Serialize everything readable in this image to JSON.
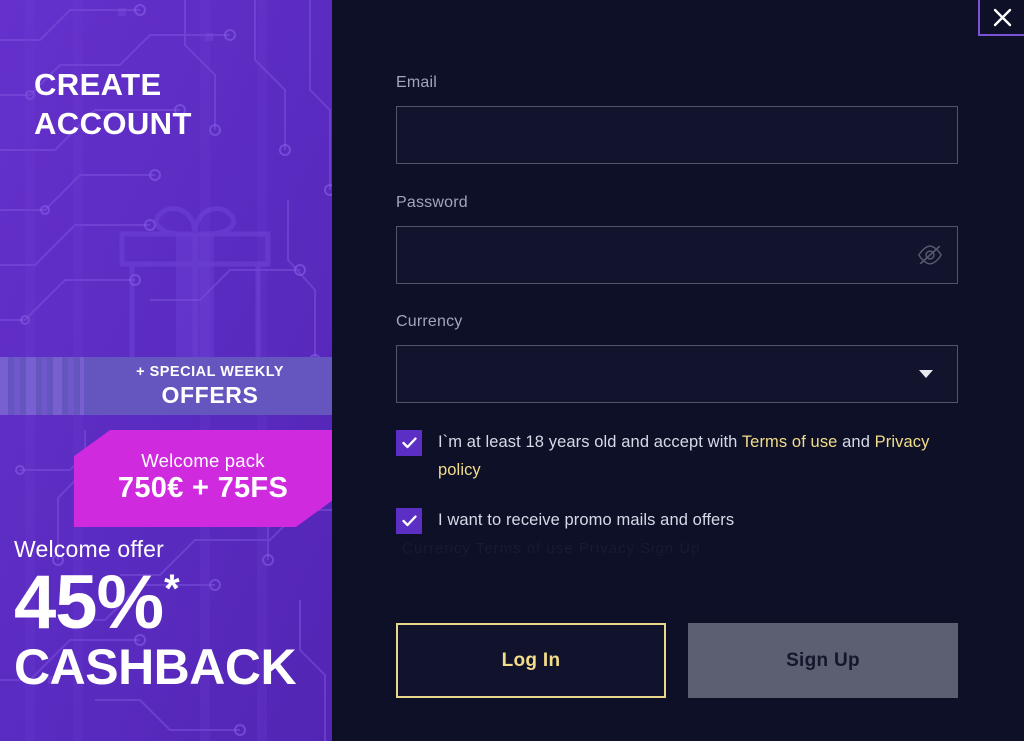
{
  "promo": {
    "title_line1": "CREATE",
    "title_line2": "ACCOUNT",
    "weekly_top": "+ SPECIAL WEEKLY",
    "weekly_bottom": "OFFERS",
    "pack_label": "Welcome pack",
    "pack_amount": "750€ + 75FS",
    "cashback_kicker": "Welcome offer",
    "cashback_percent": "45%",
    "cashback_star": "*",
    "cashback_word": "CASHBACK",
    "base_color": "#5a2bc0",
    "band_color": "#6455bf",
    "ribbon_color": "#cf2ade"
  },
  "form": {
    "close_label": "✕",
    "email": {
      "label": "Email",
      "value": "",
      "placeholder": ""
    },
    "password": {
      "label": "Password",
      "value": "",
      "placeholder": "",
      "toggle_icon": "eye-off-icon"
    },
    "currency": {
      "label": "Currency",
      "value": "",
      "placeholder": "",
      "caret_icon": "chevron-down-icon"
    },
    "terms": {
      "checked": true,
      "text_before": "I`m at least 18 years old and accept with ",
      "link_terms": "Terms of use",
      "text_middle": " and ",
      "link_privacy": "Privacy policy",
      "link_color": "#f2dd8a"
    },
    "promo_mail": {
      "checked": true,
      "text": "I want to receive promo mails and offers"
    },
    "login_button": "Log In",
    "signup_button": "Sign Up",
    "ghost_text": "Currency   Terms of use   Privacy   Sign Up",
    "panel_color": "#0d1026",
    "accent_gold": "#f2dd8a",
    "checkbox_color": "#5c2fc4"
  }
}
